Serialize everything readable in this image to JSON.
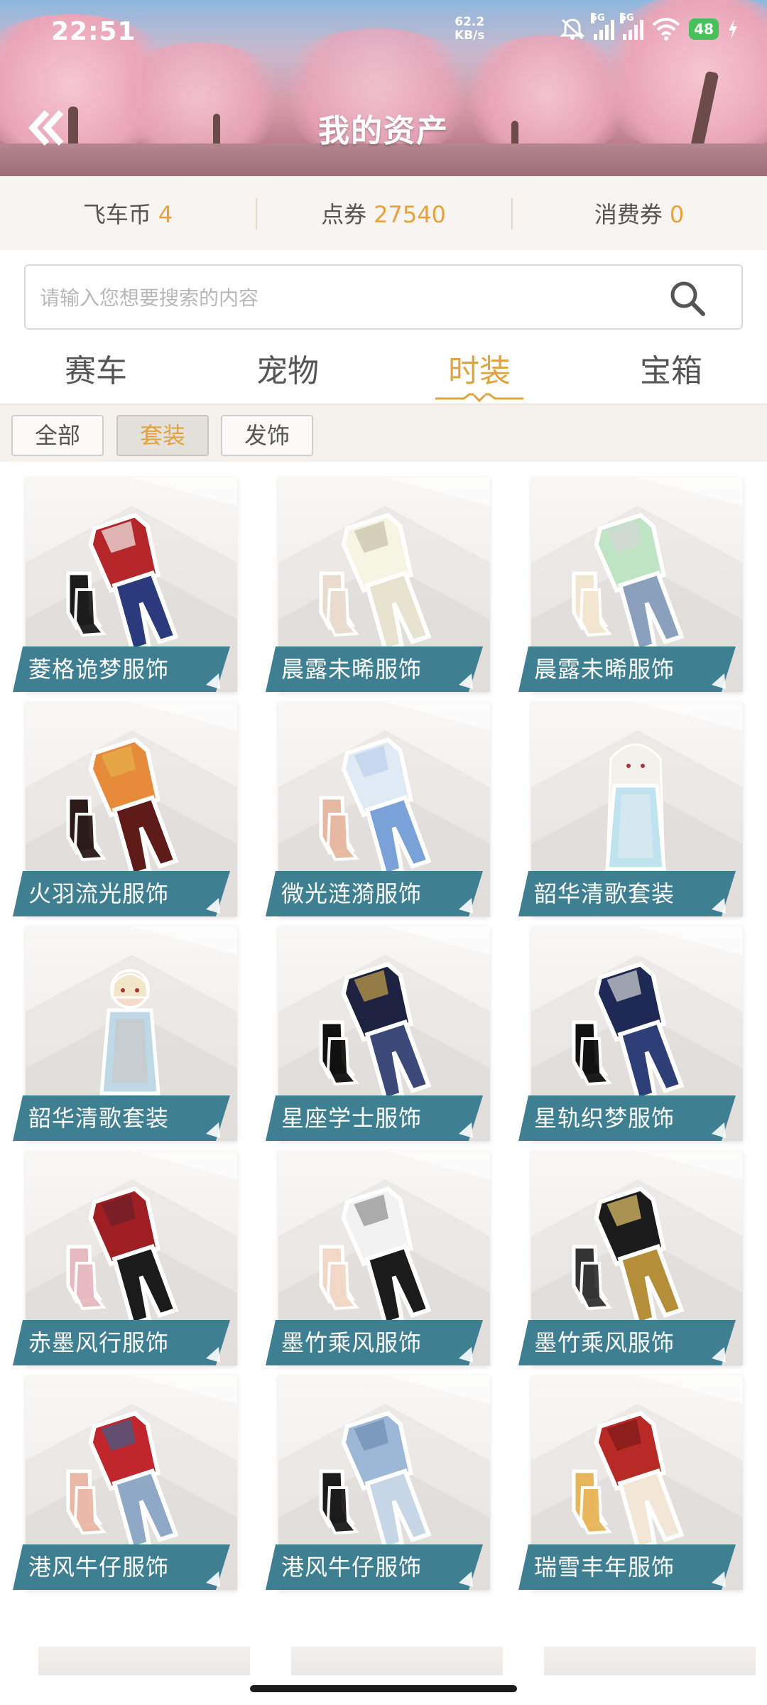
{
  "status_bar": {
    "time": "22:51",
    "net_speed_value": "62.2",
    "net_speed_unit": "KB/s",
    "sim1": "5G",
    "sim2": "5G",
    "battery": "48"
  },
  "header": {
    "title": "我的资产"
  },
  "balances": [
    {
      "label": "飞车币",
      "value": "4"
    },
    {
      "label": "点券",
      "value": "27540"
    },
    {
      "label": "消费券",
      "value": "0"
    }
  ],
  "search": {
    "placeholder": "请输入您想要搜索的内容",
    "value": ""
  },
  "tabs": [
    {
      "label": "赛车"
    },
    {
      "label": "宠物"
    },
    {
      "label": "时装",
      "active": true
    },
    {
      "label": "宝箱"
    }
  ],
  "filters": [
    {
      "label": "全部"
    },
    {
      "label": "套装",
      "active": true
    },
    {
      "label": "发饰"
    }
  ],
  "items": [
    {
      "name": "菱格诡梦服饰",
      "icon": "outfit-red-blue-icon"
    },
    {
      "name": "晨露未晞服饰",
      "icon": "outfit-white-dress-icon"
    },
    {
      "name": "晨露未晞服饰",
      "icon": "outfit-green-sweater-icon"
    },
    {
      "name": "火羽流光服饰",
      "icon": "outfit-fire-icon"
    },
    {
      "name": "微光涟漪服饰",
      "icon": "outfit-light-blue-icon"
    },
    {
      "name": "韶华清歌套装",
      "icon": "character-girl-icon"
    },
    {
      "name": "韶华清歌套装",
      "icon": "character-boy-icon"
    },
    {
      "name": "星座学士服饰",
      "icon": "outfit-navy-cloak-icon"
    },
    {
      "name": "星轨织梦服饰",
      "icon": "outfit-navy-suit-icon"
    },
    {
      "name": "赤墨风行服饰",
      "icon": "outfit-red-black-icon"
    },
    {
      "name": "墨竹乘风服饰",
      "icon": "outfit-white-black-icon"
    },
    {
      "name": "墨竹乘风服饰",
      "icon": "outfit-black-gold-icon"
    },
    {
      "name": "港风牛仔服饰",
      "icon": "outfit-red-denim-icon"
    },
    {
      "name": "港风牛仔服饰",
      "icon": "outfit-denim-icon"
    },
    {
      "name": "瑞雪丰年服饰",
      "icon": "outfit-red-qipao-icon"
    }
  ],
  "colors": {
    "accent": "#e2a33c",
    "label_bg": "#3f7f92",
    "label_bg_dark": "#2f6677"
  }
}
